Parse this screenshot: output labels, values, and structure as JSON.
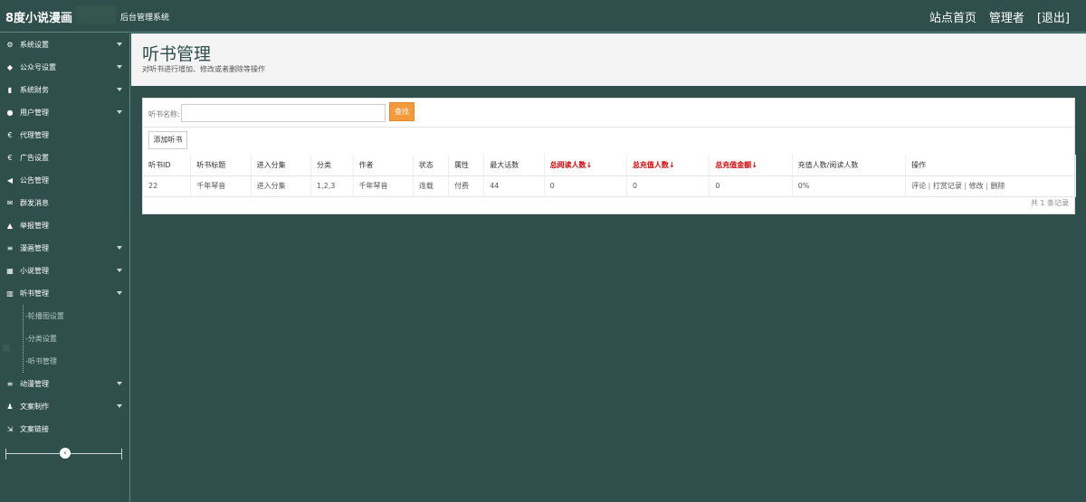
{
  "topbar": {
    "brand": "8度小说漫画",
    "system_name": "后台管理系统",
    "links": [
      "站点首页",
      "管理者",
      "[退出]"
    ]
  },
  "sidebar": {
    "items": [
      {
        "label": "系统设置",
        "icon": "gear-icon",
        "glyph": "⚙",
        "arrow": true
      },
      {
        "label": "公众号设置",
        "icon": "tag-icon",
        "glyph": "◆",
        "arrow": true
      },
      {
        "label": "系统财务",
        "icon": "bar-chart-icon",
        "glyph": "▮",
        "arrow": true
      },
      {
        "label": "用户管理",
        "icon": "user-icon",
        "glyph": "●",
        "arrow": true
      },
      {
        "label": "代理管理",
        "icon": "euro-icon",
        "glyph": "€",
        "arrow": false
      },
      {
        "label": "广告设置",
        "icon": "euro-icon",
        "glyph": "€",
        "arrow": false
      },
      {
        "label": "公告管理",
        "icon": "bullhorn-icon",
        "glyph": "◀",
        "arrow": false
      },
      {
        "label": "群发消息",
        "icon": "envelope-icon",
        "glyph": "✉",
        "arrow": false
      },
      {
        "label": "举报管理",
        "icon": "warning-icon",
        "glyph": "▲",
        "arrow": false
      },
      {
        "label": "漫画管理",
        "icon": "list-icon",
        "glyph": "≡",
        "arrow": true
      },
      {
        "label": "小说管理",
        "icon": "grid-icon",
        "glyph": "▦",
        "arrow": true
      },
      {
        "label": "听书管理",
        "icon": "chart-icon",
        "glyph": "▥",
        "arrow": true
      }
    ],
    "sub_items": [
      "-轮播图设置",
      "-分类设置",
      "-听书管理"
    ],
    "items_after": [
      {
        "label": "动漫管理",
        "icon": "list-icon",
        "glyph": "≡",
        "arrow": true
      },
      {
        "label": "文案制作",
        "icon": "user-edit-icon",
        "glyph": "♟",
        "arrow": true
      },
      {
        "label": "文案链接",
        "icon": "external-link-icon",
        "glyph": "⇲",
        "arrow": false
      }
    ],
    "collapse_glyph": "‹"
  },
  "page": {
    "title": "听书管理",
    "desc": "对听书进行增加、修改或者删除等操作"
  },
  "search": {
    "label": "听书名称:",
    "value": "",
    "button": "查找"
  },
  "add_button": "添加听书",
  "table": {
    "columns": [
      {
        "label": "听书ID",
        "red": false
      },
      {
        "label": "听书标题",
        "red": false
      },
      {
        "label": "进入分集",
        "red": false
      },
      {
        "label": "分类",
        "red": false
      },
      {
        "label": "作者",
        "red": false
      },
      {
        "label": "状态",
        "red": false
      },
      {
        "label": "属性",
        "red": false
      },
      {
        "label": "最大话数",
        "red": false
      },
      {
        "label": "总阅读人数↓",
        "red": true
      },
      {
        "label": "总充值人数↓",
        "red": true
      },
      {
        "label": "总充值金额↓",
        "red": true
      },
      {
        "label": "充值人数/阅读人数",
        "red": false
      },
      {
        "label": "操作",
        "red": false
      }
    ],
    "rows": [
      {
        "cells": [
          "22",
          "千年琴音",
          "进入分集",
          "1,2,3",
          "千年琴音",
          "连载",
          "付费",
          "44",
          "0",
          "0",
          "0",
          "0%"
        ],
        "ops": [
          "评论",
          "打赏记录",
          "修改",
          "删除"
        ]
      }
    ]
  },
  "footer": "共 1 条记录"
}
